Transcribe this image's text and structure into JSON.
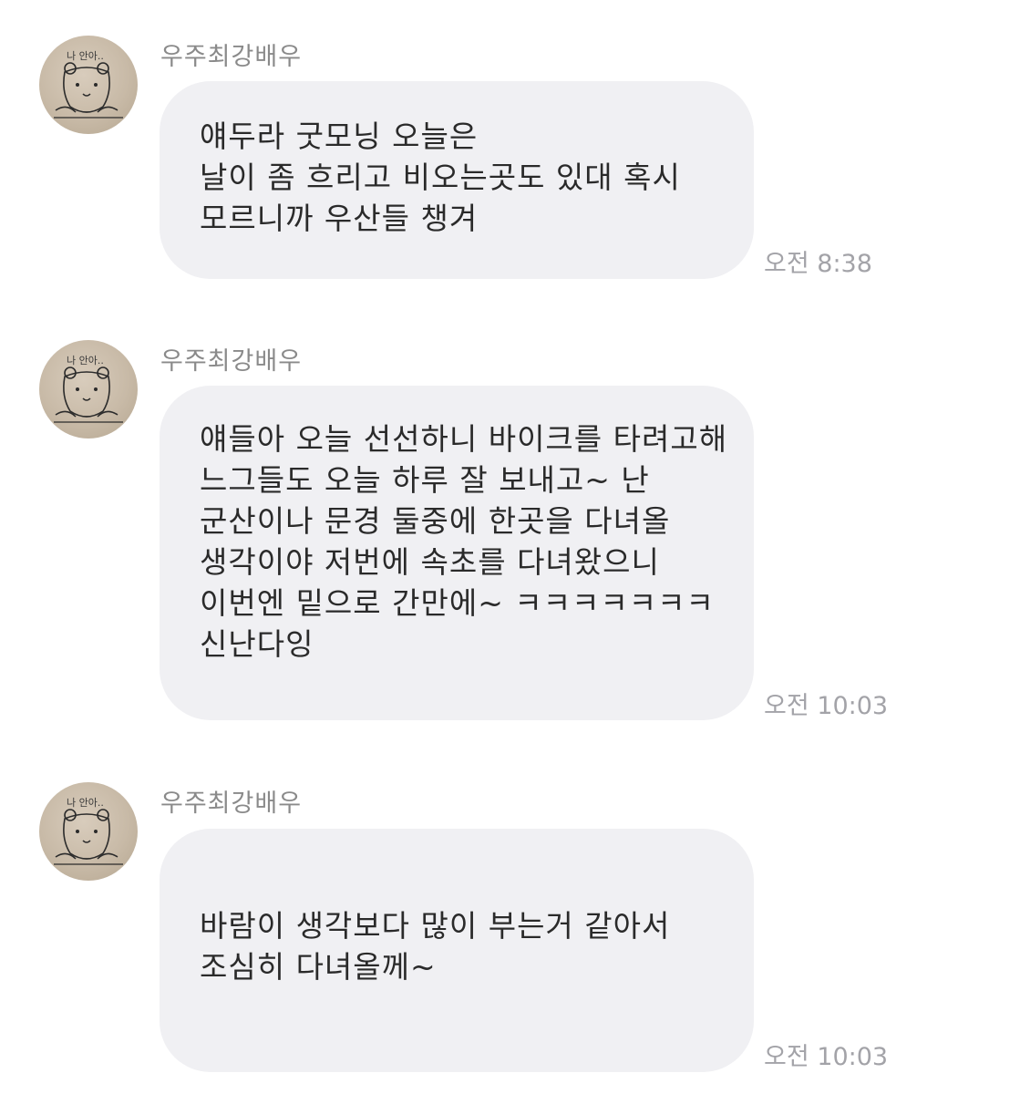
{
  "messages": [
    {
      "sender": "우주최강배우",
      "avatar_text": "나 안아..",
      "lines": [
        "얘두라 굿모닝 오늘은",
        "날이 좀 흐리고 비오는곳도 있대 혹시",
        "모르니까 우산들 챙겨"
      ],
      "time": "오전 8:38"
    },
    {
      "sender": "우주최강배우",
      "avatar_text": "나 안아..",
      "lines": [
        "얘들아 오늘 선선하니 바이크를 타려고해",
        "느그들도 오늘 하루 잘 보내고~ 난",
        "군산이나 문경 둘중에 한곳을 다녀올",
        "생각이야 저번에 속초를 다녀왔으니",
        "이번엔 밑으로 간만에~ ㅋㅋㅋㅋㅋㅋㅋ",
        "신난다잉"
      ],
      "time": "오전 10:03"
    },
    {
      "sender": "우주최강배우",
      "avatar_text": "나 안아..",
      "lines": [
        "바람이 생각보다 많이 부는거 같아서",
        "조심히 다녀올께~"
      ],
      "time": "오전 10:03"
    }
  ]
}
